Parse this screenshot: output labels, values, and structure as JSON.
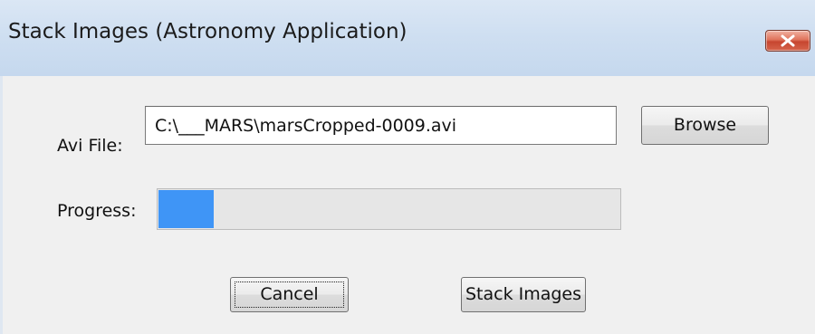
{
  "window": {
    "title": "Stack Images (Astronomy Application)",
    "close_icon": "close-icon"
  },
  "form": {
    "avi_label": "Avi File:",
    "avi_path": "C:\\___MARS\\marsCropped-0009.avi",
    "browse_label": "Browse",
    "progress_label": "Progress:",
    "progress_fraction": 0.12,
    "progress_color": "#3f95f6"
  },
  "actions": {
    "cancel_label": "Cancel",
    "stack_label": "Stack Images"
  }
}
